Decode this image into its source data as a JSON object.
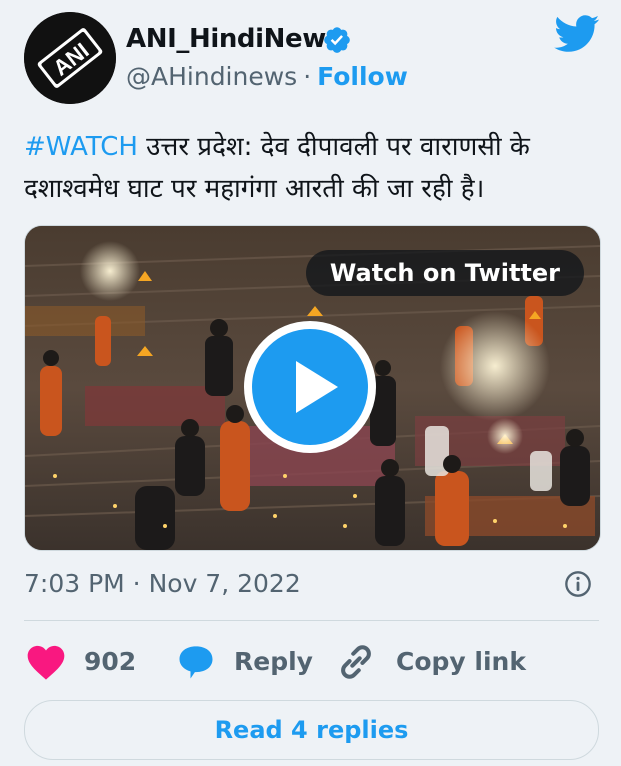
{
  "author": {
    "name": "ANI_HindiNews",
    "handle": "@AHindinews",
    "separator": "·",
    "follow_label": "Follow",
    "avatar_text": "ANI",
    "verified": true
  },
  "tweet": {
    "hashtag": "#WATCH",
    "text": " उत्तर प्रदेश: देव दीपावली पर वाराणसी के दशाश्वमेध घाट पर महागंगा आरती की जा रही है।"
  },
  "media": {
    "watch_label": "Watch on Twitter",
    "play_icon": "play-icon"
  },
  "timestamp": "7:03 PM · Nov 7, 2022",
  "actions": {
    "like_count": "902",
    "reply_label": "Reply",
    "copy_link_label": "Copy link"
  },
  "read_replies_label": "Read 4 replies",
  "colors": {
    "accent": "#1d9bf0",
    "like": "#f91880",
    "text_secondary": "#536471",
    "background": "#eef2f6"
  }
}
